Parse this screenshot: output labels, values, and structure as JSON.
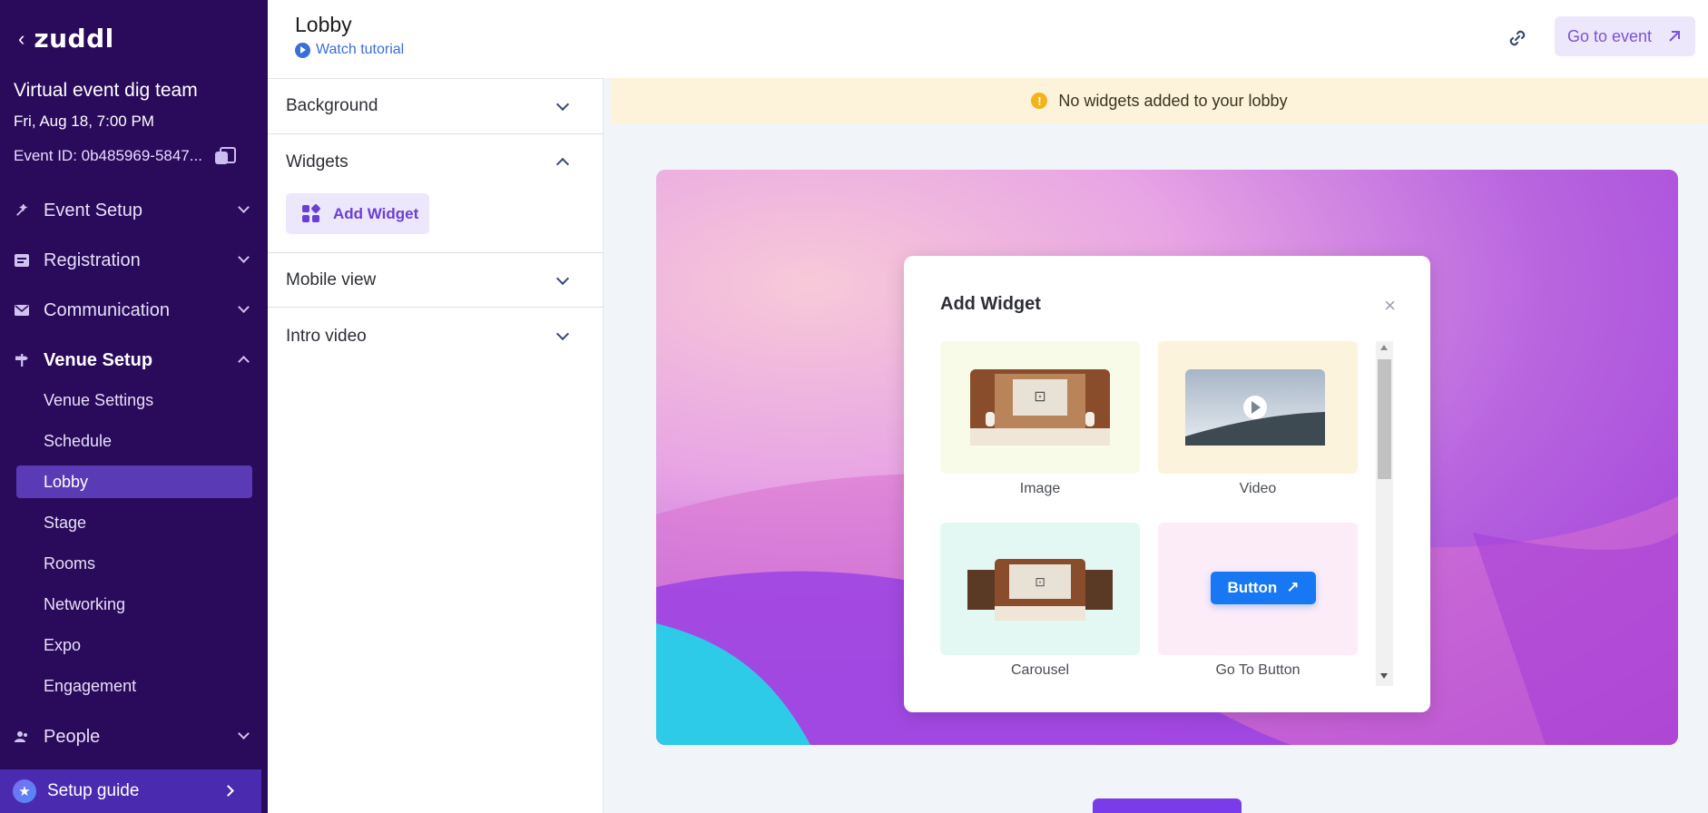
{
  "sidebar": {
    "logo": "zuddl",
    "event_name": "Virtual event dig team",
    "event_date": "Fri, Aug 18, 7:00 PM",
    "event_id": "Event ID: 0b485969-5847...",
    "sections": [
      {
        "label": "Event Setup"
      },
      {
        "label": "Registration"
      },
      {
        "label": "Communication"
      },
      {
        "label": "Venue Setup"
      },
      {
        "label": "People"
      }
    ],
    "venue_items": [
      "Venue Settings",
      "Schedule",
      "Lobby",
      "Stage",
      "Rooms",
      "Networking",
      "Expo",
      "Engagement"
    ],
    "setup_guide": "Setup guide"
  },
  "header": {
    "title": "Lobby",
    "tutorial": "Watch tutorial",
    "go_to_event": "Go to event"
  },
  "panel": {
    "accordions": [
      "Background",
      "Widgets",
      "Mobile view",
      "Intro video"
    ],
    "add_widget": "Add Widget"
  },
  "banner": {
    "text": "No widgets added to your lobby",
    "icon_text": "!"
  },
  "modal": {
    "title": "Add Widget",
    "close": "×",
    "widgets": [
      "Image",
      "Video",
      "Carousel",
      "Go To Button"
    ],
    "button_demo_label": "Button"
  },
  "colors": {
    "sidebar_bg": "#2a0a5b",
    "active_item": "#5b3ab5",
    "accent": "#7c52d8",
    "banner_bg": "#fcf3da"
  }
}
